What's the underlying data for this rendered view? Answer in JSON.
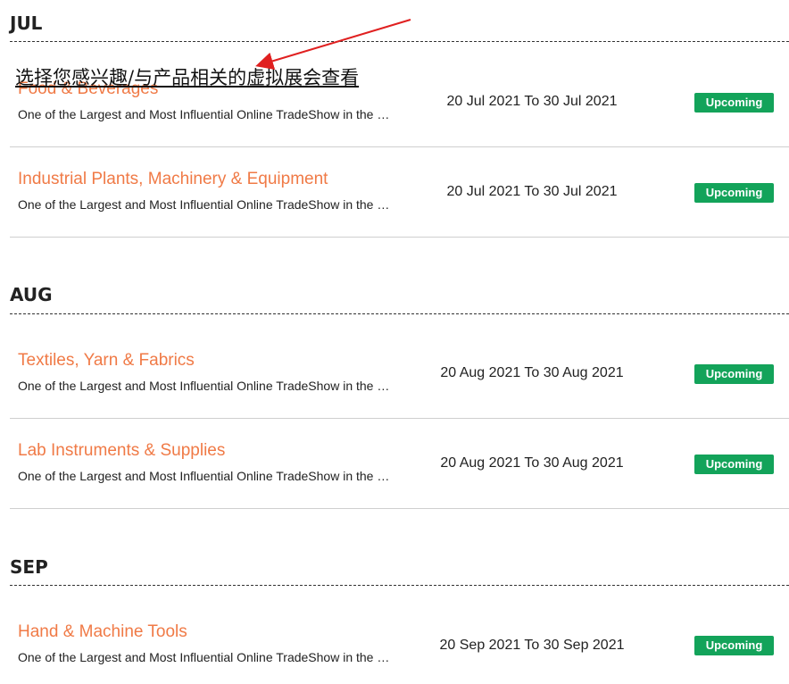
{
  "annotation": {
    "text": "选择您感兴趣/与产品相关的虚拟展会查看"
  },
  "months": [
    {
      "label": "JUL",
      "events": [
        {
          "title": "Food & Beverages",
          "description": "One of the Largest and Most Influential Online TradeShow in the …",
          "date": "20 Jul 2021 To 30 Jul 2021",
          "status": "Upcoming"
        },
        {
          "title": "Industrial Plants, Machinery & Equipment",
          "description": "One of the Largest and Most Influential Online TradeShow in the …",
          "date": "20 Jul 2021 To 30 Jul 2021",
          "status": "Upcoming"
        }
      ]
    },
    {
      "label": "AUG",
      "events": [
        {
          "title": "Textiles, Yarn & Fabrics",
          "description": "One of the Largest and Most Influential Online TradeShow in the …",
          "date": "20 Aug 2021 To 30 Aug 2021",
          "status": "Upcoming"
        },
        {
          "title": "Lab Instruments & Supplies",
          "description": "One of the Largest and Most Influential Online TradeShow in the …",
          "date": "20 Aug 2021 To 30 Aug 2021",
          "status": "Upcoming"
        }
      ]
    },
    {
      "label": "SEP",
      "events": [
        {
          "title": "Hand & Machine Tools",
          "description": "One of the Largest and Most Influential Online TradeShow in the …",
          "date": "20 Sep 2021 To 30 Sep 2021",
          "status": "Upcoming"
        }
      ]
    }
  ],
  "colors": {
    "title": "#f07a46",
    "badge": "#13a35a",
    "arrow": "#e02020"
  }
}
